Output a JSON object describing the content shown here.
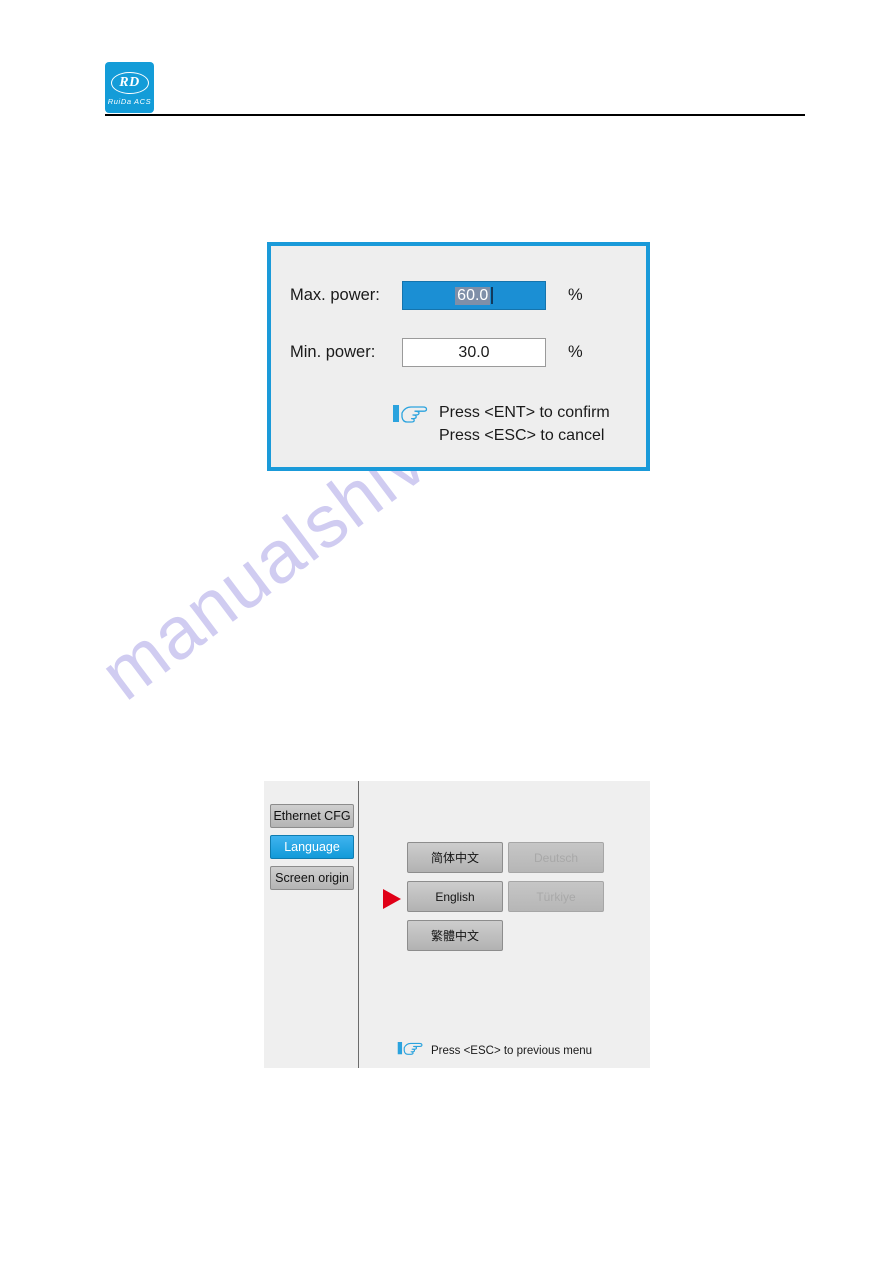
{
  "header": {
    "logo": {
      "mark": "RD",
      "subtitle": "RuiDa ACS",
      "icon_name": "ruida-acs-logo",
      "color": "#139cd8"
    }
  },
  "watermark": {
    "text": "manualshive.com",
    "color": "#c8c4ef"
  },
  "power_dialog": {
    "border_color": "#1a9ad9",
    "background": "#eeeeee",
    "fields": [
      {
        "label": "Max. power:",
        "value": "60.0",
        "unit": "%",
        "state": "focused",
        "selection_color": "#7f8fa8",
        "field_color": "#1b8fd4"
      },
      {
        "label": "Min. power:",
        "value": "30.0",
        "unit": "%",
        "state": "normal",
        "field_color": "#ffffff"
      }
    ],
    "hint": {
      "icon": "pointing-hand-icon",
      "line1": "Press <ENT> to confirm",
      "line2": "Press <ESC> to cancel"
    }
  },
  "language_panel": {
    "background": "#efefef",
    "sidebar": {
      "items": [
        {
          "label": "Ethernet CFG",
          "selected": false
        },
        {
          "label": "Language",
          "selected": true
        },
        {
          "label": "Screen origin",
          "selected": false
        }
      ],
      "selected_color": "#129ad9"
    },
    "languages": [
      {
        "label": "简体中文",
        "disabled": false
      },
      {
        "label": "Deutsch",
        "disabled": true
      },
      {
        "label": "English",
        "disabled": false
      },
      {
        "label": "Türkiye",
        "disabled": true
      },
      {
        "label": "繁體中文",
        "disabled": false
      }
    ],
    "cursor": {
      "icon": "red-triangle-cursor",
      "points_to": "English",
      "color": "#e00017"
    },
    "hint": {
      "icon": "pointing-hand-icon",
      "line1": "Press <ESC> to previous menu"
    }
  }
}
